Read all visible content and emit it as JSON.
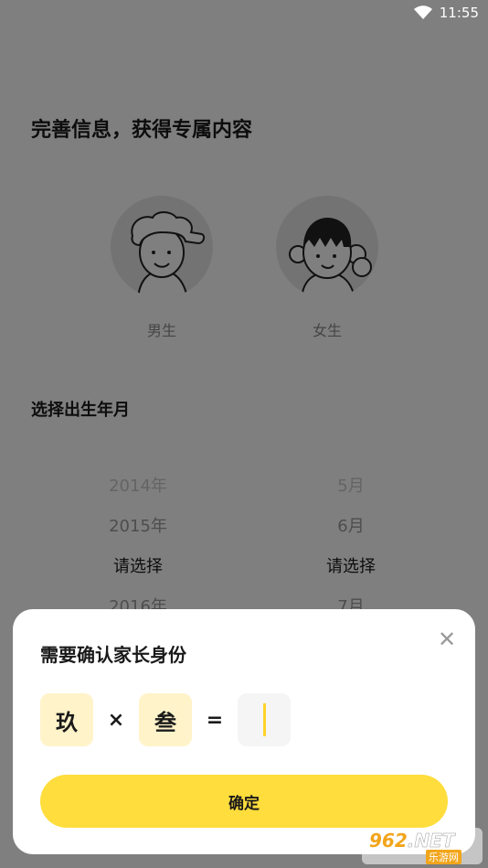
{
  "status_bar": {
    "time": "11:55"
  },
  "page": {
    "title": "完善信息，获得专属内容",
    "gender": {
      "male_label": "男生",
      "female_label": "女生"
    },
    "birth_section_title": "选择出生年月",
    "year_picker": [
      "2014年",
      "2015年",
      "请选择",
      "2016年"
    ],
    "month_picker": [
      "5月",
      "6月",
      "请选择",
      "7月"
    ]
  },
  "dialog": {
    "title": "需要确认家长身份",
    "operand_a": "玖",
    "operator": "×",
    "operand_b": "叁",
    "equals": "=",
    "confirm_label": "确定"
  },
  "watermark": {
    "digits": "962",
    "suffix": ".NET",
    "site": "乐游网"
  },
  "colors": {
    "accent": "#ffdd3c",
    "operand_bg": "#fff3c9",
    "overlay": "rgba(0,0,0,0.5)"
  }
}
